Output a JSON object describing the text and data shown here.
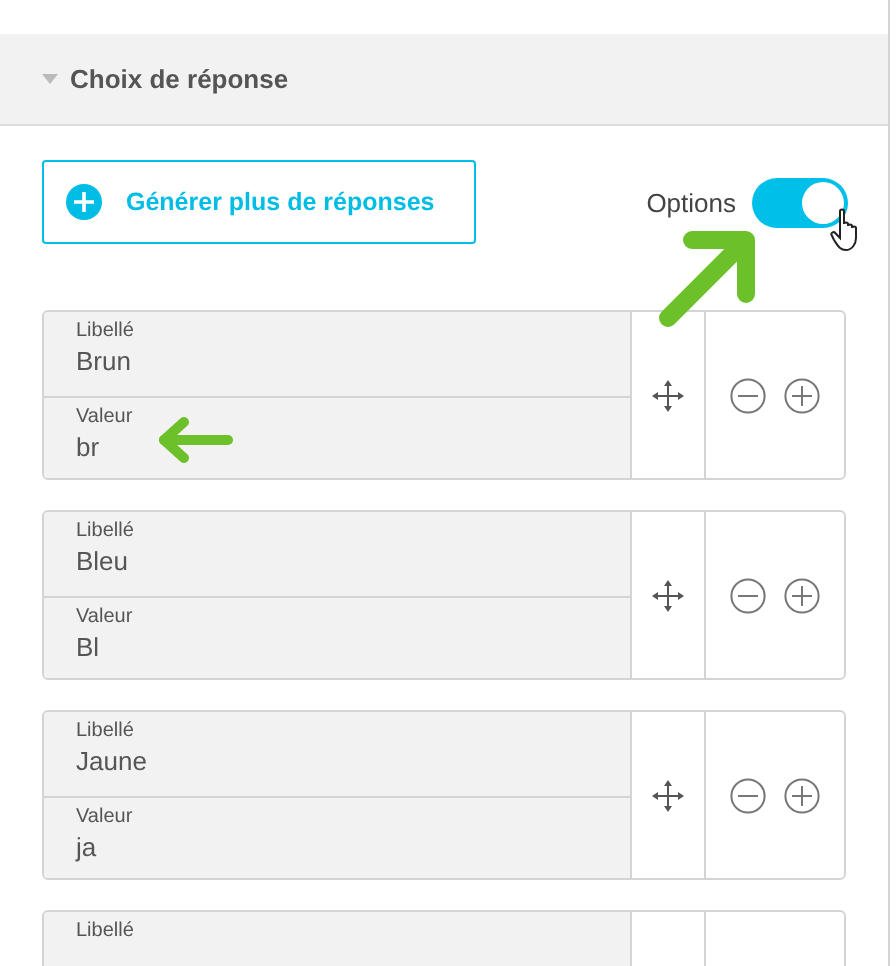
{
  "section": {
    "title": "Choix de réponse",
    "expanded": true
  },
  "generate_button": {
    "label": "Générer plus de réponses"
  },
  "options_toggle": {
    "label": "Options",
    "on": true
  },
  "answers": [
    {
      "label_caption": "Libellé",
      "label": "Brun",
      "value_caption": "Valeur",
      "value": "br"
    },
    {
      "label_caption": "Libellé",
      "label": "Bleu",
      "value_caption": "Valeur",
      "value": "Bl"
    },
    {
      "label_caption": "Libellé",
      "label": "Jaune",
      "value_caption": "Valeur",
      "value": "ja"
    },
    {
      "label_caption": "Libellé"
    }
  ]
}
